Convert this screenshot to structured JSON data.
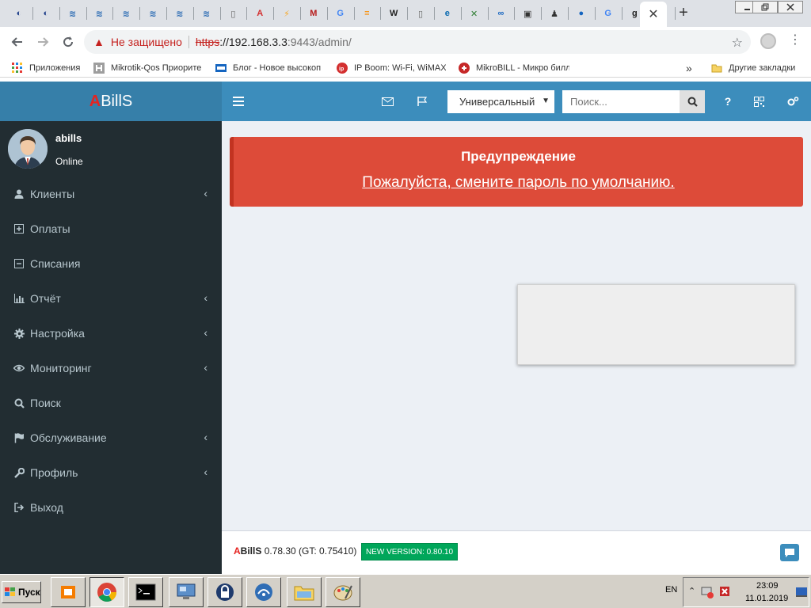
{
  "browser": {
    "tabs": [
      {
        "icon": "abills-tab-icon"
      },
      {
        "icon": "abills-tab-icon"
      },
      {
        "icon": "rss-icon"
      },
      {
        "icon": "rss-icon"
      },
      {
        "icon": "rss-icon"
      },
      {
        "icon": "rss-icon"
      },
      {
        "icon": "rss-icon"
      },
      {
        "icon": "rss-icon"
      },
      {
        "icon": "page-icon"
      },
      {
        "icon": "abills-a-icon"
      },
      {
        "icon": "bolt-icon"
      },
      {
        "icon": "mikrotik-icon"
      },
      {
        "icon": "google-icon"
      },
      {
        "icon": "layers-icon"
      },
      {
        "icon": "wikipedia-icon"
      },
      {
        "icon": "page-icon"
      },
      {
        "icon": "edge-icon"
      },
      {
        "icon": "game-icon"
      },
      {
        "icon": "network-icon"
      },
      {
        "icon": "terminal-icon"
      },
      {
        "icon": "penguin-icon"
      },
      {
        "icon": "nagios-icon"
      },
      {
        "icon": "google-icon"
      },
      {
        "icon": "g-icon"
      },
      {
        "icon": "abills-a-icon"
      }
    ],
    "active_tab_close": "✕",
    "new_tab": "+",
    "address": {
      "security_label": "Не защищено",
      "scheme": "https",
      "host_sep": "://",
      "host": "192.168.3.3",
      "path": ":9443/admin/"
    },
    "bookmarks": [
      {
        "label": "Приложения",
        "icon": "apps-icon"
      },
      {
        "label": "Mikrotik-Qos Приорите",
        "icon": "h-icon"
      },
      {
        "label": "Блог - Новое высокоп",
        "icon": "blog-icon"
      },
      {
        "label": "IP Boom: Wi-Fi, WiMAX",
        "icon": "ip-icon"
      },
      {
        "label": "MikroBILL - Микро билл",
        "icon": "mikrobill-icon"
      }
    ],
    "bookmarks_more": "»",
    "other_bookmarks": "Другие закладки",
    "accent": "#3c8dbc"
  },
  "app": {
    "logo_a": "A",
    "logo_rest": "BillS",
    "search_type": "Универсальный",
    "search_placeholder": "Поиск...",
    "help_label": "?",
    "user": {
      "name": "abills",
      "status": "Online"
    },
    "menu": [
      {
        "label": "Клиенты",
        "icon": "user-icon",
        "has_children": true
      },
      {
        "label": "Оплаты",
        "icon": "plus-square-icon",
        "has_children": false
      },
      {
        "label": "Списания",
        "icon": "minus-square-icon",
        "has_children": false
      },
      {
        "label": "Отчёт",
        "icon": "bar-chart-icon",
        "has_children": true
      },
      {
        "label": "Настройка",
        "icon": "gear-icon",
        "has_children": true
      },
      {
        "label": "Мониторинг",
        "icon": "eye-icon",
        "has_children": true
      },
      {
        "label": "Поиск",
        "icon": "search-icon",
        "has_children": false
      },
      {
        "label": "Обслуживание",
        "icon": "flag-icon",
        "has_children": true
      },
      {
        "label": "Профиль",
        "icon": "wrench-icon",
        "has_children": true
      },
      {
        "label": "Выход",
        "icon": "sign-out-icon",
        "has_children": false
      }
    ],
    "alert": {
      "title": "Предупреждение",
      "message": "Пожалуйста, смените пароль по умолчанию."
    },
    "footer": {
      "brand_a": "A",
      "brand_rest": "BillS",
      "version": "0.78.30 (GT: 0.75410)",
      "new_version": "NEW VERSION: 0.80.10"
    }
  },
  "taskbar": {
    "start_label": "Пуск",
    "language": "EN",
    "time": "23:09",
    "date": "11.01.2019"
  }
}
